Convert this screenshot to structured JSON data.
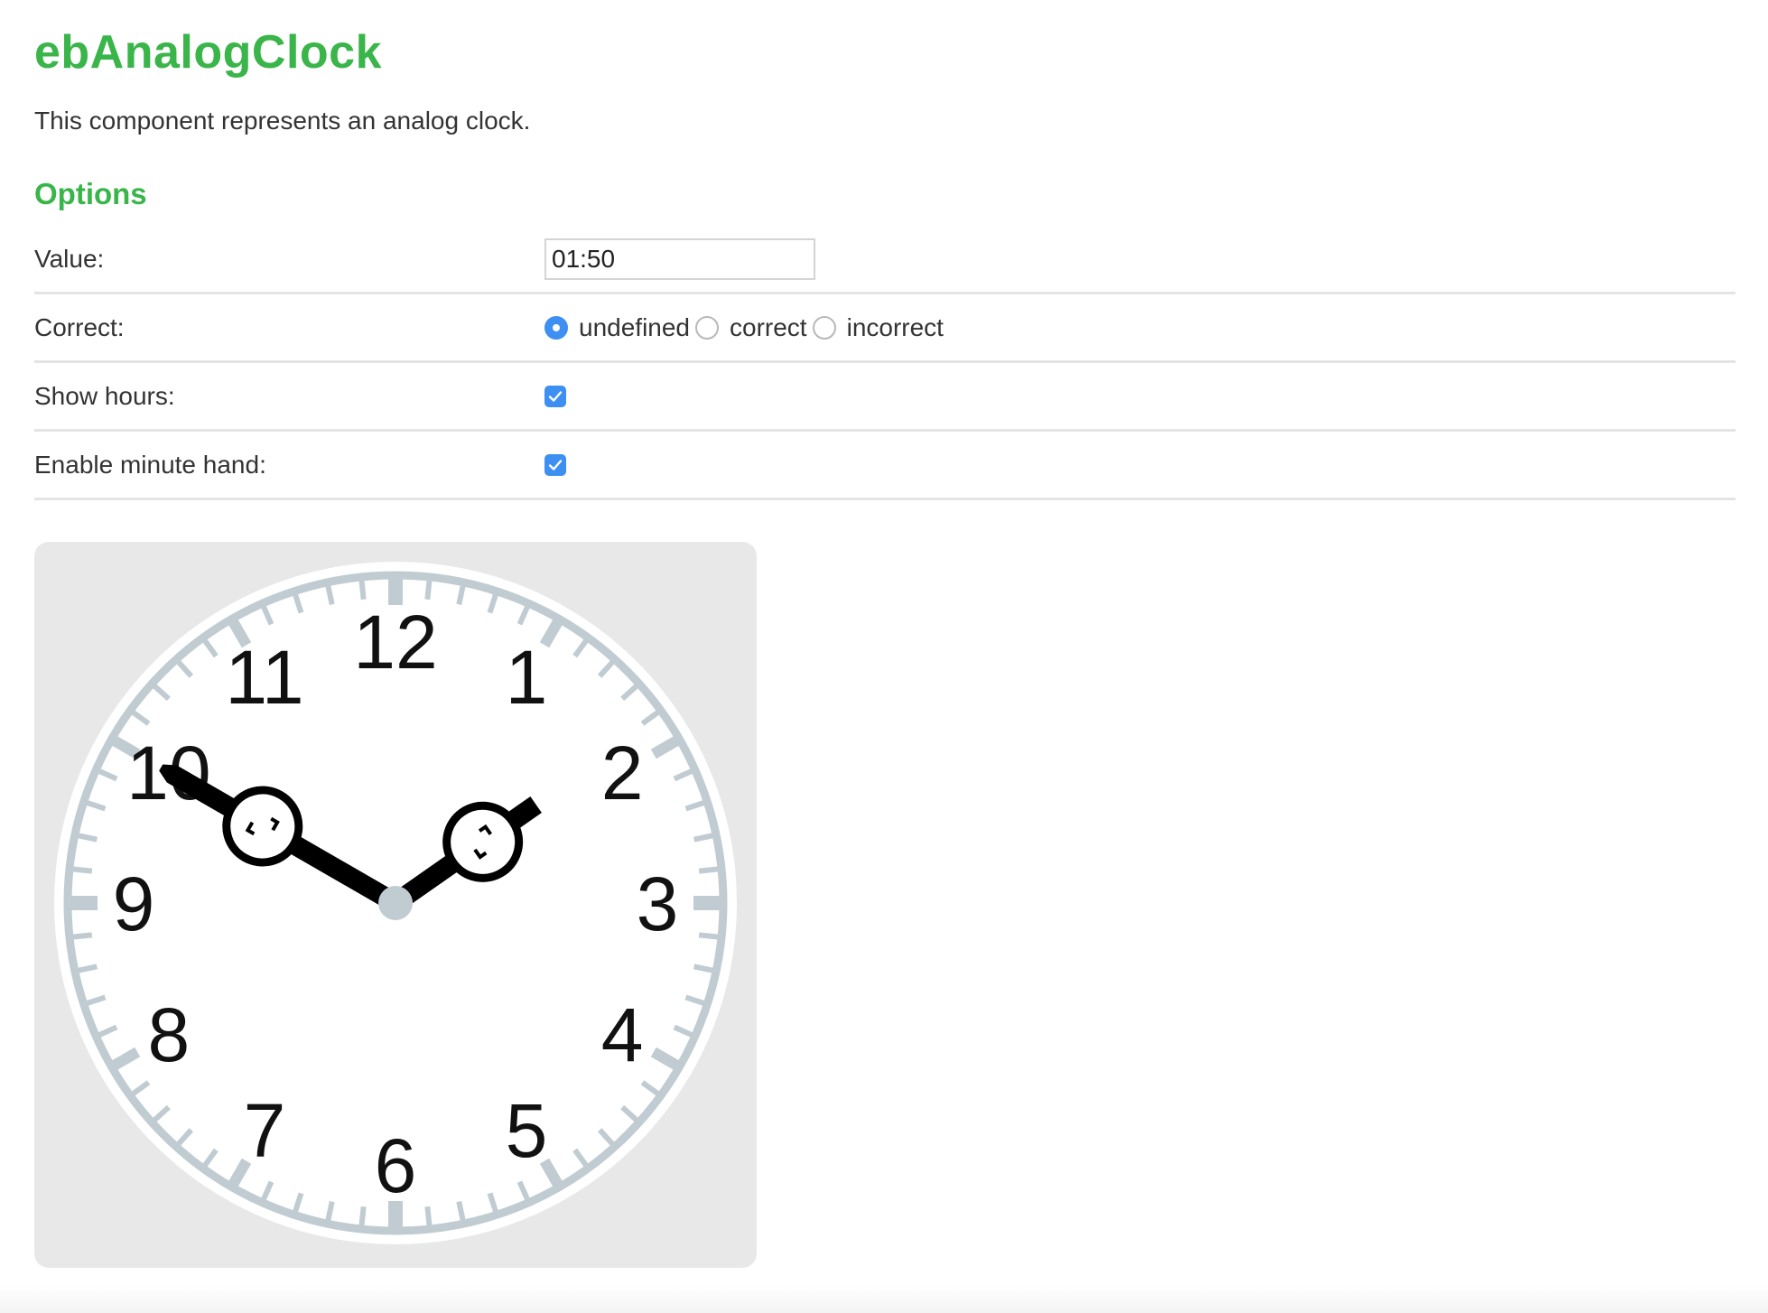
{
  "page": {
    "title": "ebAnalogClock",
    "description": "This component represents an analog clock."
  },
  "options": {
    "heading": "Options",
    "value": {
      "label": "Value:",
      "input_value": "01:50"
    },
    "correct": {
      "label": "Correct:",
      "choices": [
        {
          "label": "undefined",
          "checked": true
        },
        {
          "label": "correct",
          "checked": false
        },
        {
          "label": "incorrect",
          "checked": false
        }
      ]
    },
    "show_hours": {
      "label": "Show hours:",
      "checked": true
    },
    "enable_minute_hand": {
      "label": "Enable minute hand:",
      "checked": true
    }
  },
  "clock": {
    "time": "01:50",
    "hour": 1,
    "minute": 50,
    "hour_numbers": [
      "12",
      "1",
      "2",
      "3",
      "4",
      "5",
      "6",
      "7",
      "8",
      "9",
      "10",
      "11"
    ],
    "colors": {
      "panel": "#e8e8e8",
      "face": "#ffffff",
      "ticks": "#c0ccd2",
      "hands": "#000000",
      "center": "#c0ccd2",
      "accent": "#3ab54a",
      "control": "#3d8ff2"
    }
  }
}
